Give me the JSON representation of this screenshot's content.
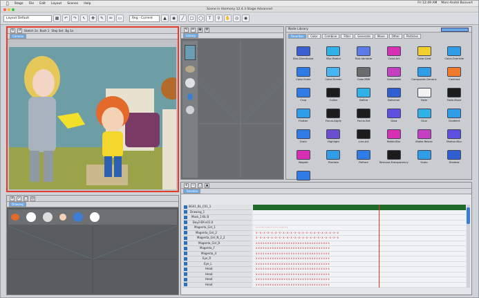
{
  "menubar": {
    "items": [
      "Stage",
      "File",
      "Edit",
      "Layout",
      "Scenes",
      "Help"
    ],
    "right": [
      "Fri 12:49 AM",
      "Marc-André Boisvert"
    ]
  },
  "window": {
    "title": "Scene in Harmony 12.4.3 Stage Advanced"
  },
  "toolbar": {
    "workspace": "Layout Default",
    "scene_dropdown": "Reg - Current"
  },
  "camera_panel": {
    "title": "Camera",
    "tool_labels": [
      "Sketch 1a",
      "Bush 1",
      "Step Set",
      "Bg 1a"
    ]
  },
  "library_panel": {
    "title": "Library"
  },
  "fx_panel": {
    "title": "Node Library",
    "tabs": [
      "Favorites",
      "Color",
      "Combine",
      "Filter",
      "Generate",
      "Move",
      "Other",
      "Particles"
    ],
    "effects": [
      {
        "label": "Blur-Directional",
        "color": "#3a5fd0"
      },
      {
        "label": "Blur-Radial",
        "color": "#2fb3e6"
      },
      {
        "label": "Blur-Variable",
        "color": "#5a7be8"
      },
      {
        "label": "Color-Art",
        "color": "#d62fb3"
      },
      {
        "label": "Color-Card",
        "color": "#f2d02b"
      },
      {
        "label": "Color-Override",
        "color": "#2f9ce6"
      },
      {
        "label": "Color-Scale",
        "color": "#2f7ce6"
      },
      {
        "label": "Color-Screen",
        "color": "#45b6f0"
      },
      {
        "label": "Color2BW",
        "color": "#6b6b6b"
      },
      {
        "label": "Composite",
        "color": "#c43fc2"
      },
      {
        "label": "Composite-Generic",
        "color": "#2f9ce6"
      },
      {
        "label": "Contrast",
        "color": "#f27a2b"
      },
      {
        "label": "Crop",
        "color": "#2f7ce6"
      },
      {
        "label": "Cutter",
        "color": "#1c1c1c"
      },
      {
        "label": "Define",
        "color": "#2fb3e6"
      },
      {
        "label": "Deformer",
        "color": "#2f5fd0"
      },
      {
        "label": "Fade",
        "color": "#f2f2f2"
      },
      {
        "label": "Fade-Move",
        "color": "#1c1c1c"
      },
      {
        "label": "Flatten",
        "color": "#2f9ce6"
      },
      {
        "label": "Focus-Apply",
        "color": "#1c1c1c"
      },
      {
        "label": "Focus-Set",
        "color": "#1c1c1c"
      },
      {
        "label": "Glow",
        "color": "#5d4fe0"
      },
      {
        "label": "Glue",
        "color": "#2fb3e6"
      },
      {
        "label": "Gradient",
        "color": "#2f9ce6"
      },
      {
        "label": "Grain",
        "color": "#2f7ce6"
      },
      {
        "label": "Highlight",
        "color": "#6b4fd0"
      },
      {
        "label": "Line-Art",
        "color": "#1c1c1c"
      },
      {
        "label": "Matte-Blur",
        "color": "#d62fb3"
      },
      {
        "label": "Matte-Resize",
        "color": "#c43fc2"
      },
      {
        "label": "Motion-Blur",
        "color": "#5d4fe0"
      },
      {
        "label": "Negate",
        "color": "#d62fb3"
      },
      {
        "label": "Pixelate",
        "color": "#2f9ce6"
      },
      {
        "label": "Refract",
        "color": "#2f7ce6"
      },
      {
        "label": "Remove-Transparency",
        "color": "#1c1c1c"
      },
      {
        "label": "Scale",
        "color": "#2f9ce6"
      },
      {
        "label": "Shadow",
        "color": "#2f5fd0"
      },
      {
        "label": "Tone",
        "color": "#2f7ce6"
      }
    ]
  },
  "drawing_panel": {
    "title": "Drawing"
  },
  "timeline_panel": {
    "title": "Timeline",
    "layers": [
      "BG01_BL_C01_1",
      "Drawing_1",
      "Mask_1-BL B",
      "Boy2-BX-v01.0",
      "Magenta_Girl_1",
      "Magenta_Girl_2",
      "Magenta_Girl_N_2_2",
      "Magenta_Girl_B",
      "Magenta_F",
      "Magenta_4",
      "Eye_R",
      "Eye_L",
      "Head",
      "Head",
      "Head",
      "Head"
    ],
    "row_marks": [
      "",
      "",
      "",
      "ꞏꞏꞏꞏꞏꞏꞏꞏꞏꞏꞏꞏꞏꞏꞏꞏꞏꞏꞏꞏꞏ",
      "xꞏxꞏxꞏxꞏxꞏxꞏxꞏxꞏxꞏxꞏxꞏxꞏxꞏxꞏxꞏxꞏxꞏxꞏxꞏxꞏxꞏx",
      "xꞏxꞏxꞏxꞏxꞏxꞏxꞏxꞏxꞏxꞏxꞏxꞏxꞏxꞏxꞏxꞏxꞏxꞏxꞏxꞏxꞏx",
      "xxxxxxxxxxxxxxxxxxxxxxxxxxxxxxxx",
      "xxxxxxxxxxxxxxxxxxxxxxxxxxxxxxxx",
      "xxxxxxxxxxxxxxxxxxxxxxxxxxxxxxxx",
      "xxxxxxxxxxxxxxxxxxxxxxxxxxxxxxxx",
      "xxxxxxxxxxxxxxxxxxxxxxxxxxxxxxxx",
      "xxxxxxxxxxxxxxxxxxxxxxxxxxxxxxxx",
      "xxxxxxxxxxxxxxxxxxxxxxxxxxxxxxxx",
      "xxxxxxxxxxxxxxxxxxxxxxxxxxxxxxxx",
      "xxxxxxxxxxxxxxxxxxxxxxxxxxxxxxxx",
      "xxxxxxxxxxxxxxxxxxxxxxxxxxxxxxxx"
    ]
  },
  "colors": {
    "accent": "#3d7dd4",
    "camera_border": "#e53b2b",
    "playhead": "#e03030"
  }
}
